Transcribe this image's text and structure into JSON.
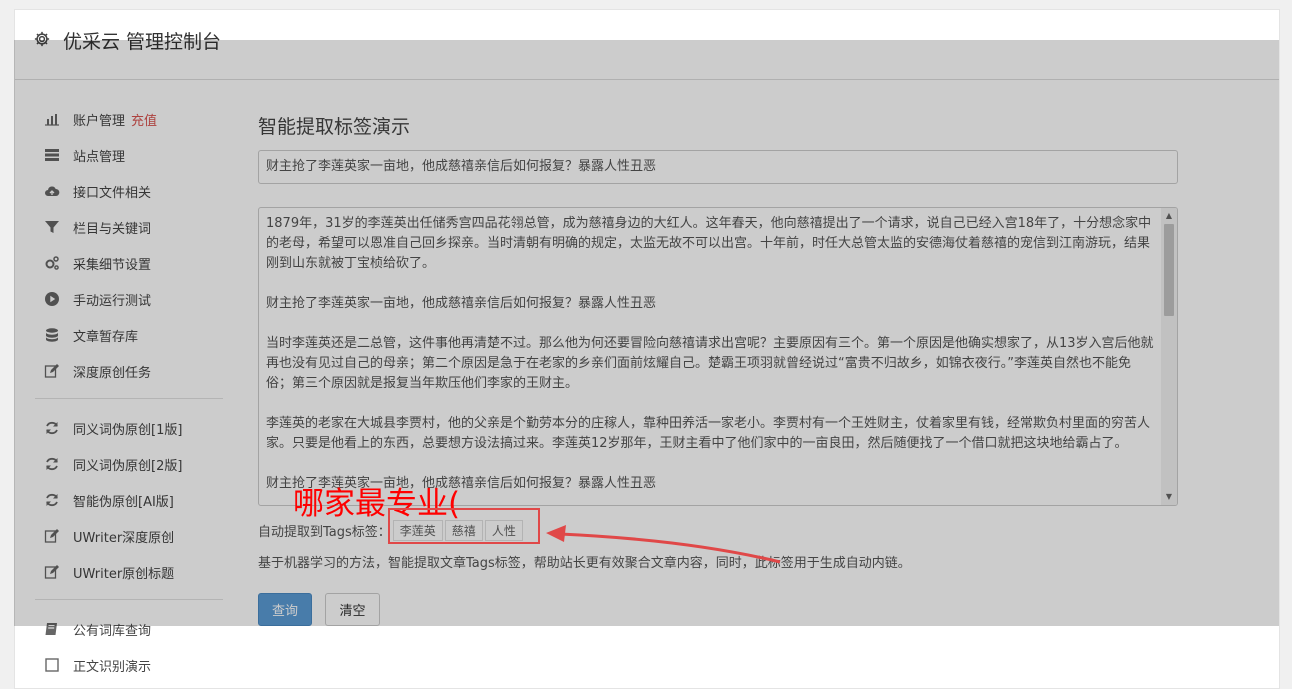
{
  "header": {
    "title": "优采云 管理控制台",
    "icon": "gear-icon"
  },
  "sidebar": {
    "account": {
      "label": "账户管理",
      "badge": "充值",
      "icon": "bar-chart-icon"
    },
    "items": [
      {
        "label": "站点管理",
        "icon": "server-icon"
      },
      {
        "label": "接口文件相关",
        "icon": "cloud-upload-icon"
      },
      {
        "label": "栏目与关键词",
        "icon": "filter-icon"
      },
      {
        "label": "采集细节设置",
        "icon": "cogs-icon"
      },
      {
        "label": "手动运行测试",
        "icon": "play-circle-icon"
      },
      {
        "label": "文章暂存库",
        "icon": "database-icon"
      },
      {
        "label": "深度原创任务",
        "icon": "edit-icon"
      },
      {
        "label": "同义词伪原创[1版]",
        "icon": "refresh-icon"
      },
      {
        "label": "同义词伪原创[2版]",
        "icon": "refresh-icon"
      },
      {
        "label": "智能伪原创[AI版]",
        "icon": "refresh-icon"
      },
      {
        "label": "UWriter深度原创",
        "icon": "edit-icon"
      },
      {
        "label": "UWriter原创标题",
        "icon": "edit-icon"
      },
      {
        "label": "公有词库查询",
        "icon": "book-icon"
      },
      {
        "label": "正文识别演示",
        "icon": "square-icon"
      }
    ]
  },
  "main": {
    "heading": "智能提取标签演示",
    "title_value": "财主抢了李莲英家一亩地，他成慈禧亲信后如何报复？暴露人性丑恶",
    "content_paragraphs": [
      "1879年，31岁的李莲英出任储秀宫四品花翎总管，成为慈禧身边的大红人。这年春天，他向慈禧提出了一个请求，说自己已经入宫18年了，十分想念家中的老母，希望可以恩准自己回乡探亲。当时清朝有明确的规定，太监无故不可以出宫。十年前，时任大总管太监的安德海仗着慈禧的宠信到江南游玩，结果刚到山东就被丁宝桢给砍了。",
      "财主抢了李莲英家一亩地，他成慈禧亲信后如何报复？暴露人性丑恶",
      "当时李莲英还是二总管，这件事他再清楚不过。那么他为何还要冒险向慈禧请求出宫呢？主要原因有三个。第一个原因是他确实想家了，从13岁入宫后他就再也没有见过自己的母亲；第二个原因是急于在老家的乡亲们面前炫耀自己。楚霸王项羽就曾经说过“富贵不归故乡，如锦衣夜行。”李莲英自然也不能免俗；第三个原因就是报复当年欺压他们李家的王财主。",
      "李莲英的老家在大城县李贾村，他的父亲是个勤劳本分的庄稼人，靠种田养活一家老小。李贾村有一个王姓财主，仗着家里有钱，经常欺负村里面的穷苦人家。只要是他看上的东西，总要想方设法搞过来。李莲英12岁那年，王财主看中了他们家中的一亩良田，然后随便找了一个借口就把这块地给霸占了。",
      "财主抢了李莲英家一亩地，他成慈禧亲信后如何报复？暴露人性丑恶"
    ],
    "tags_label": "自动提取到Tags标签：",
    "tags": [
      "李莲英",
      "慈禧",
      "人性"
    ],
    "description": "基于机器学习的方法，智能提取文章Tags标签，帮助站长更有效聚合文章内容，同时，此标签用于生成自动内链。",
    "query_label": "查询",
    "clear_label": "清空"
  },
  "annotation": {
    "text": "哪家最专业(",
    "color": "#ff0000"
  }
}
